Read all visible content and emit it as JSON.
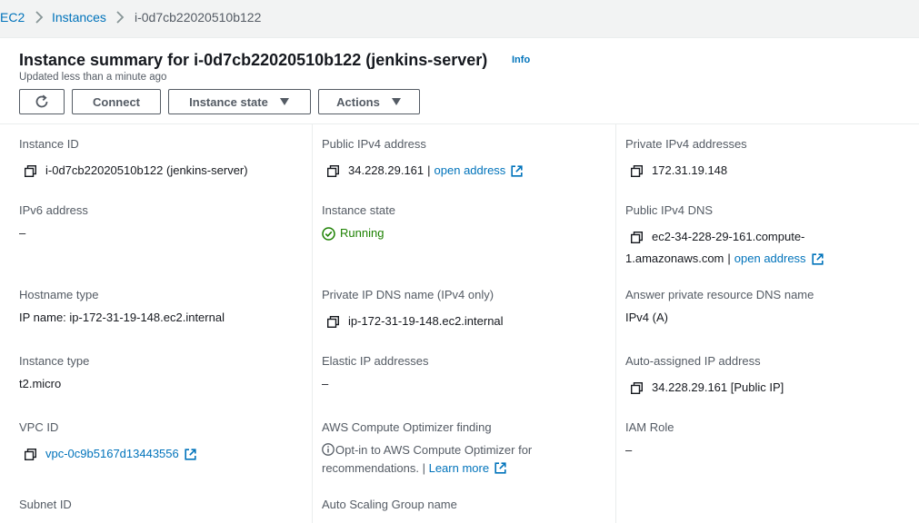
{
  "breadcrumb": {
    "items": [
      "EC2",
      "Instances"
    ],
    "current": "i-0d7cb22020510b122"
  },
  "header": {
    "title": "Instance summary for i-0d7cb22020510b122 (jenkins-server)",
    "info": "Info",
    "updated": "Updated less than a minute ago",
    "buttons": {
      "refresh_icon": "refresh-icon",
      "connect": "Connect",
      "instance_state": "Instance state",
      "actions": "Actions"
    }
  },
  "details": {
    "col1": {
      "instance_id": {
        "label": "Instance ID",
        "value": "i-0d7cb22020510b122 (jenkins-server)"
      },
      "ipv6": {
        "label": "IPv6 address",
        "value": "–"
      },
      "hostname_type": {
        "label": "Hostname type",
        "value": "IP name: ip-172-31-19-148.ec2.internal"
      },
      "instance_type": {
        "label": "Instance type",
        "value": "t2.micro"
      },
      "vpc_id": {
        "label": "VPC ID",
        "value": "vpc-0c9b5167d13443556"
      },
      "subnet_id": {
        "label": "Subnet ID"
      }
    },
    "col2": {
      "public_ipv4": {
        "label": "Public IPv4 address",
        "value": "34.228.29.161",
        "sep": "|",
        "link": "open address"
      },
      "instance_state": {
        "label": "Instance state",
        "value": "Running"
      },
      "private_dns": {
        "label": "Private IP DNS name (IPv4 only)",
        "value": "ip-172-31-19-148.ec2.internal"
      },
      "elastic_ip": {
        "label": "Elastic IP addresses",
        "value": "–"
      },
      "optimizer": {
        "label": "AWS Compute Optimizer finding",
        "value": "Opt-in to AWS Compute Optimizer for recommendations.",
        "sep": "|",
        "link": "Learn more"
      },
      "asg": {
        "label": "Auto Scaling Group name"
      }
    },
    "col3": {
      "private_ipv4": {
        "label": "Private IPv4 addresses",
        "value": "172.31.19.148"
      },
      "public_dns": {
        "label": "Public IPv4 DNS",
        "value_line1": "ec2-34-228-29-161.compute-",
        "value_line2": "1.amazonaws.com",
        "sep": "|",
        "link": "open address"
      },
      "answer_dns": {
        "label": "Answer private resource DNS name",
        "value": "IPv4 (A)"
      },
      "auto_ip": {
        "label": "Auto-assigned IP address",
        "value": "34.228.29.161 [Public IP]"
      },
      "iam_role": {
        "label": "IAM Role",
        "value": "–"
      }
    }
  },
  "colors": {
    "link": "#0073bb",
    "running": "#1d8102",
    "label": "#545b64",
    "text": "#16191f"
  }
}
